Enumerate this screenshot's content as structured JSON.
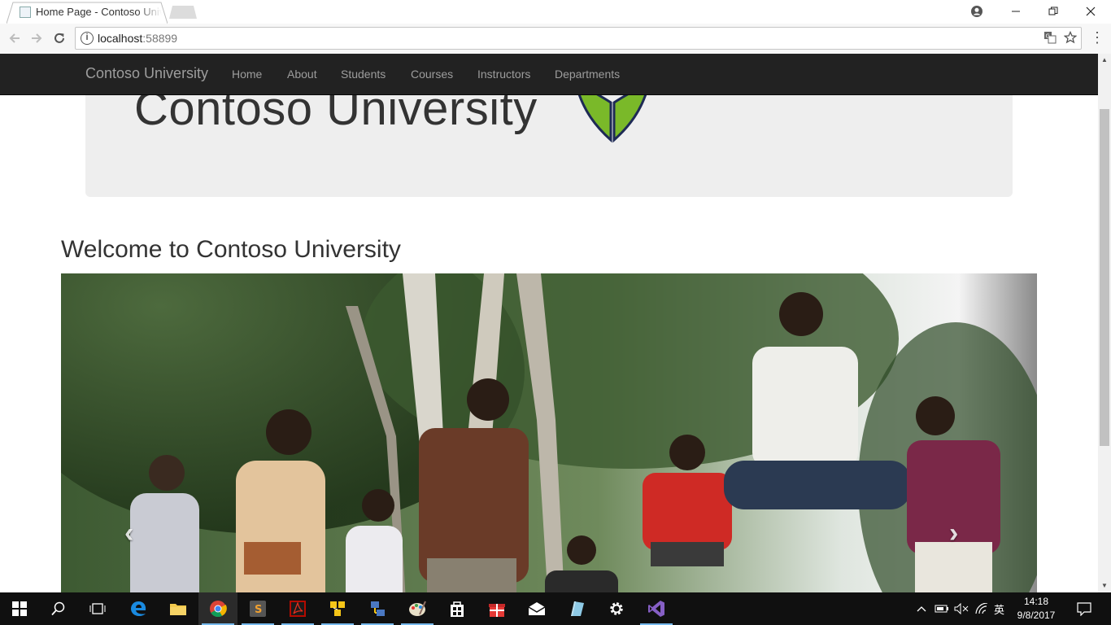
{
  "browser": {
    "tab_title": "Home Page - Contoso University",
    "url_host": "localhost",
    "url_port": ":58899",
    "icons": [
      "page-favicon",
      "new-tab",
      "profile-icon",
      "minimize-icon",
      "restore-icon",
      "close-icon",
      "back-icon",
      "forward-icon",
      "reload-icon",
      "info-icon",
      "translate-icon",
      "star-icon",
      "menu-icon"
    ]
  },
  "navbar": {
    "brand": "Contoso University",
    "links": [
      "Home",
      "About",
      "Students",
      "Courses",
      "Instructors",
      "Departments"
    ]
  },
  "jumbotron": {
    "title": "Contoso University"
  },
  "main": {
    "heading": "Welcome to Contoso University"
  },
  "carousel": {
    "prev": "‹",
    "next": "›"
  },
  "taskbar": {
    "apps": [
      "windows-start",
      "search",
      "task-view",
      "edge",
      "file-explorer",
      "chrome",
      "sublime-text",
      "acrobat-reader",
      "app-yellow",
      "network-app",
      "paint",
      "store",
      "gift-app",
      "mail",
      "app-blue",
      "settings",
      "visual-studio"
    ],
    "tray_lang": "英",
    "time": "14:18",
    "date": "9/8/2017"
  },
  "colors": {
    "navbar_bg": "#222222",
    "navbar_text": "#9d9d9d",
    "jumbotron_bg": "#eeeeee",
    "logo_green": "#7ab929",
    "logo_navy": "#1e2a55",
    "taskbar_bg": "#101010"
  }
}
